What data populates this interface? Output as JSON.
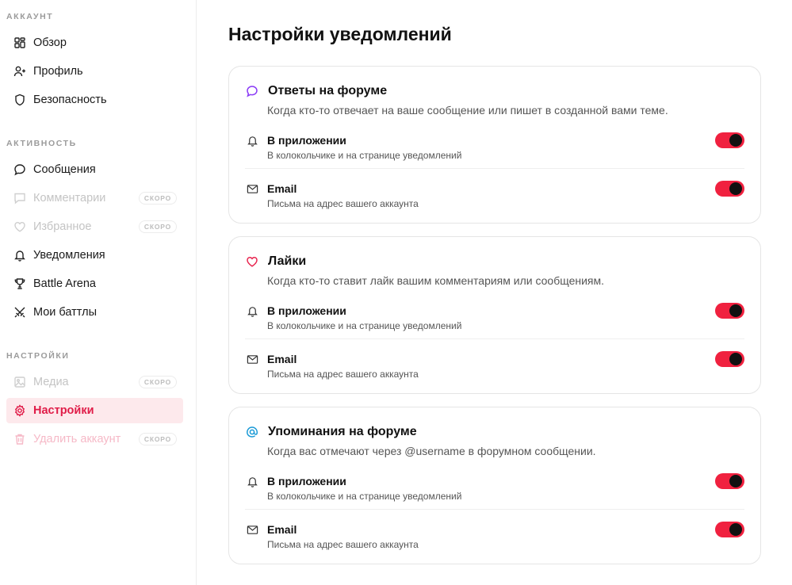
{
  "sidebar": {
    "sections": [
      {
        "title": "АККАУНТ"
      },
      {
        "title": "АКТИВНОСТЬ"
      },
      {
        "title": "НАСТРОЙКИ"
      }
    ],
    "items": [
      {
        "label": "Обзор",
        "icon": "overview-grid-icon"
      },
      {
        "label": "Профиль",
        "icon": "user-profile-icon"
      },
      {
        "label": "Безопасность",
        "icon": "shield-icon"
      },
      {
        "label": "Сообщения",
        "icon": "message-bubble-icon"
      },
      {
        "label": "Комментарии",
        "icon": "comment-icon",
        "badge": "СКОРО"
      },
      {
        "label": "Избранное",
        "icon": "heart-icon",
        "badge": "СКОРО"
      },
      {
        "label": "Уведомления",
        "icon": "bell-icon"
      },
      {
        "label": "Battle Arena",
        "icon": "trophy-icon"
      },
      {
        "label": "Мои баттлы",
        "icon": "crossed-swords-icon"
      },
      {
        "label": "Медиа",
        "icon": "image-icon",
        "badge": "СКОРО"
      },
      {
        "label": "Настройки",
        "icon": "gear-icon"
      },
      {
        "label": "Удалить аккаунт",
        "icon": "trash-icon",
        "badge": "СКОРО"
      }
    ]
  },
  "main": {
    "title": "Настройки уведомлений",
    "cards": [
      {
        "title": "Ответы на форуме",
        "icon": "message-bubble-icon",
        "icon_color": "#8b3cf6",
        "description": "Когда кто-то отвечает на ваше сообщение или пишет в созданной вами теме.",
        "rows": [
          {
            "title": "В приложении",
            "subtitle": "В колокольчике и на странице уведомлений",
            "enabled": true
          },
          {
            "title": "Email",
            "subtitle": "Письма на адрес вашего аккаунта",
            "enabled": true
          }
        ]
      },
      {
        "title": "Лайки",
        "icon": "heart-icon",
        "icon_color": "#e8254f",
        "description": "Когда кто-то ставит лайк вашим комментариям или сообщениям.",
        "rows": [
          {
            "title": "В приложении",
            "subtitle": "В колокольчике и на странице уведомлений",
            "enabled": true
          },
          {
            "title": "Email",
            "subtitle": "Письма на адрес вашего аккаунта",
            "enabled": true
          }
        ]
      },
      {
        "title": "Упоминания на форуме",
        "icon": "at-sign-icon",
        "icon_color": "#1a9ad6",
        "description": "Когда вас отмечают через @username в форумном сообщении.",
        "rows": [
          {
            "title": "В приложении",
            "subtitle": "В колокольчике и на странице уведомлений",
            "enabled": true
          },
          {
            "title": "Email",
            "subtitle": "Письма на адрес вашего аккаунта",
            "enabled": true
          }
        ]
      }
    ]
  },
  "colors": {
    "accent": "#e01c48",
    "toggle_on": "#f0213f",
    "active_bg": "#fde9ec"
  }
}
